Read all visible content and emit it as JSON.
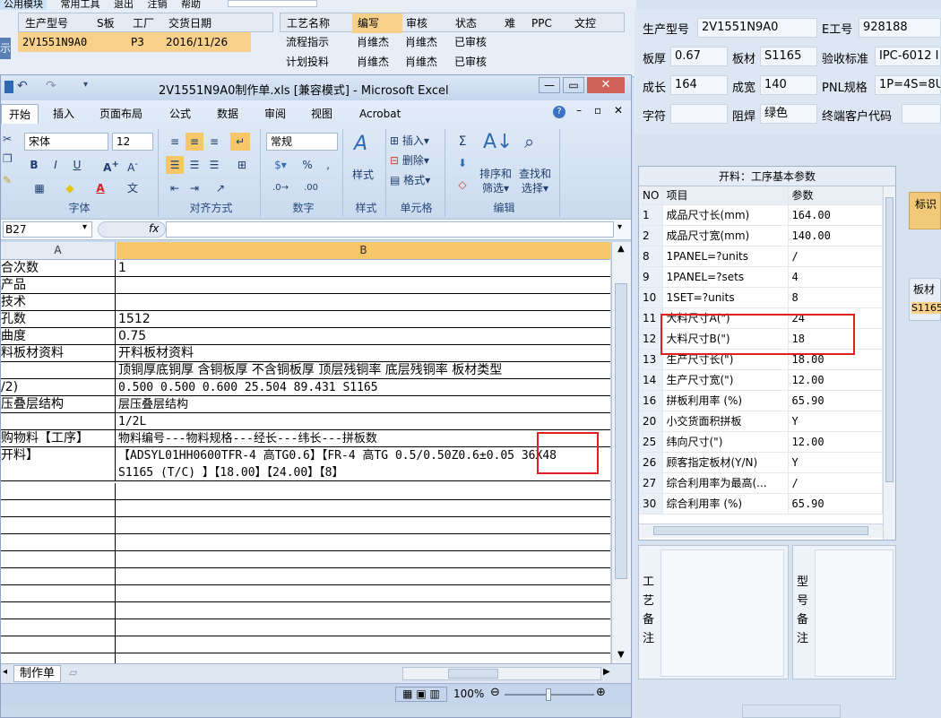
{
  "bg_app": {
    "menu_items": [
      "公用模块",
      "常用工具",
      "退出",
      "注销",
      "帮助"
    ],
    "grid1": {
      "headers": [
        "生产型号",
        "S板",
        "工厂",
        "交货日期"
      ],
      "row": [
        "2V1551N9A0",
        "",
        "P3",
        "2016/11/26"
      ]
    },
    "grid2": {
      "headers": [
        "工艺名称",
        "编写",
        "审核",
        "状态",
        "难",
        "PPC",
        "文控"
      ],
      "rows": [
        [
          "流程指示",
          "肖维杰",
          "肖维杰",
          "已审核"
        ],
        [
          "计划投料",
          "肖维杰",
          "肖维杰",
          "已审核"
        ]
      ]
    },
    "side_fragment": "示"
  },
  "info_panel": {
    "fields": [
      {
        "label": "生产型号",
        "value": "2V1551N9A0"
      },
      {
        "label": "E工号",
        "value": "928188"
      },
      {
        "label": "板厚",
        "value": "0.67"
      },
      {
        "label": "板材",
        "value": "S1165"
      },
      {
        "label": "验收标准",
        "value": "IPC-6012 I"
      },
      {
        "label": "成长",
        "value": "164"
      },
      {
        "label": "成宽",
        "value": "140"
      },
      {
        "label": "PNL规格",
        "value": "1P=4S=8U"
      },
      {
        "label": "字符",
        "value": ""
      },
      {
        "label": "阻焊",
        "value": "绿色"
      },
      {
        "label": "终端客户代码",
        "value": ""
      }
    ]
  },
  "param_panel": {
    "title": "开料：工序基本参数",
    "headers": [
      "NO",
      "项目",
      "参数"
    ],
    "rows": [
      [
        "1",
        "成品尺寸长(mm)",
        "164.00"
      ],
      [
        "2",
        "成品尺寸宽(mm)",
        "140.00"
      ],
      [
        "8",
        "1PANEL=?units",
        "/"
      ],
      [
        "9",
        "1PANEL=?sets",
        "4"
      ],
      [
        "10",
        "1SET=?units",
        "8"
      ],
      [
        "11",
        "大料尺寸A(\")",
        "24"
      ],
      [
        "12",
        "大料尺寸B(\")",
        "18"
      ],
      [
        "13",
        "生产尺寸长(\")",
        "18.00"
      ],
      [
        "14",
        "生产尺寸宽(\")",
        "12.00"
      ],
      [
        "16",
        "拼板利用率 (%)",
        "65.90"
      ],
      [
        "20",
        "小交货面积拼板",
        "Y"
      ],
      [
        "25",
        "纬向尺寸(\")",
        "12.00"
      ],
      [
        "26",
        "顾客指定板材(Y/N)",
        "Y"
      ],
      [
        "27",
        "综合利用率为最高(...",
        "/"
      ],
      [
        "30",
        "综合利用率 (%)",
        "65.90"
      ]
    ],
    "remark_label": "工艺备注",
    "type_remark_label": "型号备注"
  },
  "far_right": {
    "tag1": "标识",
    "tag2": "板材",
    "tag2_value": "S1165"
  },
  "excel": {
    "title": "2V1551N9A0制作单.xls  [兼容模式] - Microsoft Excel",
    "tabs": [
      "开始",
      "插入",
      "页面布局",
      "公式",
      "数据",
      "审阅",
      "视图",
      "Acrobat"
    ],
    "font_name": "宋体",
    "font_size": "12",
    "number_format": "常规",
    "group_labels": [
      "字体",
      "对齐方式",
      "数字",
      "样式",
      "单元格",
      "编辑"
    ],
    "cell_btns": [
      "插入",
      "删除",
      "格式"
    ],
    "style_btn": "样式",
    "sort_btn": [
      "排序和",
      "筛选"
    ],
    "find_btn": [
      "查找和",
      "选择"
    ],
    "name_box": "B27",
    "fx": "fx",
    "col_a": "A",
    "col_b": "B",
    "rows": [
      {
        "a": "合次数",
        "b": "1"
      },
      {
        "a": "产品",
        "b": ""
      },
      {
        "a": "技术",
        "b": ""
      },
      {
        "a": "孔数",
        "b": "1512"
      },
      {
        "a": "曲度",
        "b": "0.75"
      },
      {
        "a": "料板材资料",
        "b": "开料板材资料"
      },
      {
        "a": "",
        "b": "顶铜厚底铜厚 含铜板厚 不含铜板厚 顶层残铜率 底层残铜率 板材类型"
      },
      {
        "a": "/2)",
        "b": "0.500  0.500        0.600       25.504    89.431      S1165"
      },
      {
        "a": "压叠层结构",
        "b": "层压叠层结构"
      },
      {
        "a": "",
        "b": "1/2L"
      },
      {
        "a": "购物料【工序】",
        "b": "物料编号---物料规格---经长---纬长---拼板数"
      },
      {
        "a": "开料】",
        "b": "【ADSYL01HH0600TFR-4 高TG0.6】【FR-4 高TG 0.5/0.50Z0.6±0.05 36X48"
      },
      {
        "a": "",
        "b": "S1165 (T/C)  】【18.00】【24.00】【8】"
      }
    ],
    "sheet_tab": "制作单",
    "zoom": "100%"
  }
}
